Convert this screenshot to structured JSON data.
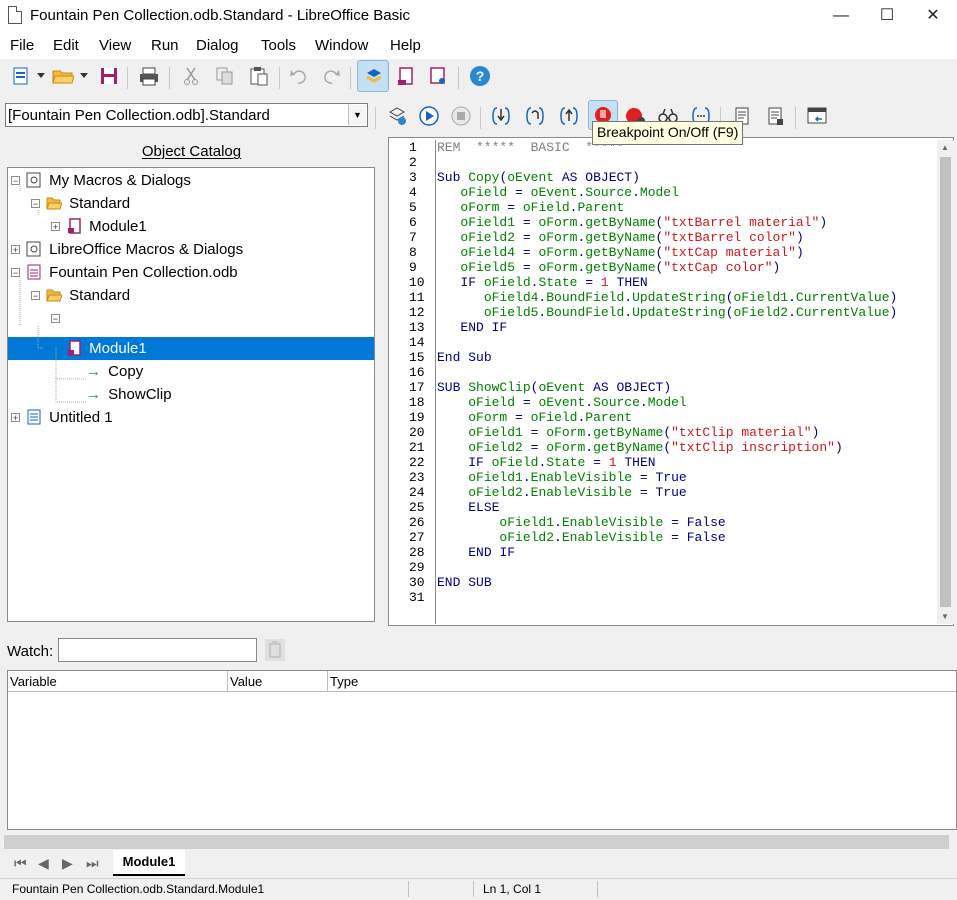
{
  "window": {
    "title": "Fountain Pen Collection.odb.Standard - LibreOffice Basic",
    "controls": {
      "minimize": "—",
      "maximize": "☐",
      "close": "✕"
    }
  },
  "menu": [
    "File",
    "Edit",
    "View",
    "Run",
    "Dialog",
    "Tools",
    "Window",
    "Help"
  ],
  "toolbar": {
    "standard_icons": [
      "new-document-icon",
      "open-folder-icon",
      "save-icon",
      "print-icon",
      "cut-icon",
      "copy-icon",
      "paste-icon",
      "undo-icon",
      "redo-icon",
      "select-macro-icon",
      "insert-module-icon",
      "dialog-icon",
      "help-icon"
    ],
    "library_select": "[Fountain Pen Collection.odb].Standard",
    "basic_icons": [
      "compile-icon",
      "run-icon",
      "stop-icon",
      "step-into-icon",
      "step-over-icon",
      "step-out-icon",
      "breakpoint-icon",
      "manage-breakpoints-icon",
      "watch-icon",
      "find-parentheses-icon",
      "insert-source-icon",
      "save-source-icon",
      "export-dialog-icon"
    ]
  },
  "tooltip": "Breakpoint On/Off (F9)",
  "catalog": {
    "heading": "Object Catalog",
    "nodes": [
      {
        "label": "My Macros & Dialogs"
      },
      {
        "label": "Standard"
      },
      {
        "label": "Module1"
      },
      {
        "label": "LibreOffice Macros & Dialogs"
      },
      {
        "label": "Fountain Pen Collection.odb"
      },
      {
        "label": "Standard"
      },
      {
        "label": "Module1"
      },
      {
        "label": "Copy"
      },
      {
        "label": "ShowClip"
      },
      {
        "label": "Untitled 1"
      }
    ]
  },
  "code_lines": [
    "REM  *****  BASIC  *****",
    "",
    "Sub Copy(oEvent AS OBJECT)",
    "   oField = oEvent.Source.Model",
    "   oForm = oField.Parent",
    "   oField1 = oForm.getByName(\"txtBarrel material\")",
    "   oField2 = oForm.getByName(\"txtBarrel color\")",
    "   oField4 = oForm.getByName(\"txtCap material\")",
    "   oField5 = oForm.getByName(\"txtCap color\")",
    "   IF oField.State = 1 THEN",
    "      oField4.BoundField.UpdateString(oField1.CurrentValue)",
    "      oField5.BoundField.UpdateString(oField2.CurrentValue)",
    "   END IF",
    "",
    "End Sub",
    "",
    "SUB ShowClip(oEvent AS OBJECT)",
    "    oField = oEvent.Source.Model",
    "    oForm = oField.Parent",
    "    oField1 = oForm.getByName(\"txtClip material\")",
    "    oField2 = oForm.getByName(\"txtClip inscription\")",
    "    IF oField.State = 1 THEN",
    "    oField1.EnableVisible = True",
    "    oField2.EnableVisible = True",
    "    ELSE",
    "        oField1.EnableVisible = False",
    "        oField2.EnableVisible = False",
    "    END IF",
    "",
    "END SUB",
    ""
  ],
  "line_numbers": [
    "1",
    "2",
    "3",
    "4",
    "5",
    "6",
    "7",
    "8",
    "9",
    "10",
    "11",
    "12",
    "13",
    "14",
    "15",
    "16",
    "17",
    "18",
    "19",
    "20",
    "21",
    "22",
    "23",
    "24",
    "25",
    "26",
    "27",
    "28",
    "29",
    "30",
    "31"
  ],
  "watch": {
    "label": "Watch:",
    "value": "",
    "columns": [
      "Variable",
      "Value",
      "Type"
    ]
  },
  "tabs": {
    "module_tab": "Module1",
    "nav": [
      "⏮",
      "◀",
      "▶",
      "⏭"
    ]
  },
  "status": {
    "location": "Fountain Pen Collection.odb.Standard.Module1",
    "position": "Ln 1, Col 1"
  },
  "colors": {
    "selection": "#0078d7",
    "keyword": "#000080",
    "identifier": "#008000",
    "string": "#ce181e",
    "comment": "#808080"
  }
}
